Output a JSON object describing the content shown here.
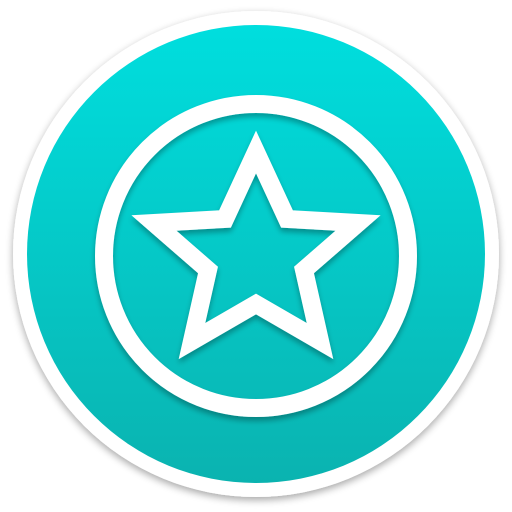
{
  "icon": {
    "name": "star-badge-icon",
    "colors": {
      "background": "#ffffff",
      "outer_ring": "#ffffff",
      "teal_top": "#00dede",
      "teal_bottom": "#0ab3b0",
      "glyph": "#ffffff",
      "shadow": "#000000"
    }
  }
}
